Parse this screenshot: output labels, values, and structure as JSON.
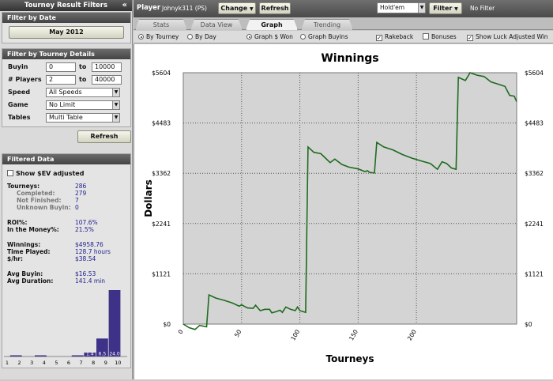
{
  "left": {
    "header": "Tourney Result Filters",
    "collapse_glyph": "«",
    "date_section": {
      "title": "Filter by Date",
      "button": "May 2012"
    },
    "details_section": {
      "title": "Filter by Tourney Details",
      "buyin_label": "Buyin",
      "buyin_min": "0",
      "buyin_to": "to",
      "buyin_max": "10000",
      "players_label": "# Players",
      "players_min": "2",
      "players_to": "to",
      "players_max": "40000",
      "speed_label": "Speed",
      "speed_value": "All Speeds",
      "game_label": "Game",
      "game_value": "No Limit",
      "tables_label": "Tables",
      "tables_value": "Multi Table"
    },
    "refresh_button": "Refresh",
    "filtered": {
      "title": "Filtered Data",
      "sev_label": "Show $EV adjusted",
      "tourneys_label": "Tourneys:",
      "tourneys": "286",
      "completed_label": "Completed:",
      "completed": "279",
      "not_finished_label": "Not Finished:",
      "not_finished": "7",
      "unknown_label": "Unknown Buyin:",
      "unknown": "0",
      "roi_label": "ROI%:",
      "roi": "107.6%",
      "itm_label": "In the Money%:",
      "itm": "21.5%",
      "winnings_label": "Winnings:",
      "winnings": "$4958.76",
      "time_label": "Time Played:",
      "time": "128.7 hours",
      "hr_label": "$/hr:",
      "hr": "$38.54",
      "avg_buyin_label": "Avg Buyin:",
      "avg_buyin": "$16.53",
      "avg_dur_label": "Avg Duration:",
      "avg_dur": "141.4 min"
    },
    "finish_chart": {
      "x_labels": [
        "1",
        "2",
        "3",
        "4",
        "5",
        "6",
        "7",
        "8",
        "9",
        "10"
      ],
      "bars": [
        {
          "pos": 1,
          "value": 0.3
        },
        {
          "pos": 3,
          "value": 0.3
        },
        {
          "pos": 6,
          "value": 0.3
        },
        {
          "pos": 7,
          "value": 1.4,
          "label": "1.4"
        },
        {
          "pos": 8,
          "value": 6.5,
          "label": "6.5"
        },
        {
          "pos": 9,
          "value": 24.0,
          "label": "24.0"
        }
      ],
      "color": "#3d3188"
    }
  },
  "topbar": {
    "player_label": "Player",
    "player_name": "Johnyk311 (PS)",
    "change_btn": "Change",
    "refresh_btn": "Refresh",
    "game_select": "Hold'em",
    "filter_btn": "Filter",
    "filter_status": "No Filter"
  },
  "tabs": [
    "Stats",
    "Data View",
    "Graph",
    "Trending"
  ],
  "active_tab": "Graph",
  "options": {
    "by_tourney": "By Tourney",
    "by_day": "By Day",
    "graph_won": "Graph $ Won",
    "graph_buyins": "Graph Buyins",
    "rakeback": "Rakeback",
    "bonuses": "Bonuses",
    "luck": "Show Luck Adjusted Win"
  },
  "chart_data": {
    "type": "line",
    "title": "Winnings",
    "xlabel": "Tourneys",
    "ylabel": "Dollars",
    "xlim": [
      0,
      286
    ],
    "ylim": [
      0,
      5604
    ],
    "yticks": [
      "$0",
      "$1121",
      "$2241",
      "$3362",
      "$4483",
      "$5604"
    ],
    "xticks": [
      "0",
      "50",
      "100",
      "150",
      "200"
    ],
    "grid": true,
    "series": [
      {
        "color": "#1e6b1e",
        "points": [
          [
            0,
            0
          ],
          [
            5,
            -80
          ],
          [
            10,
            -120
          ],
          [
            14,
            -30
          ],
          [
            20,
            -60
          ],
          [
            22,
            650
          ],
          [
            28,
            580
          ],
          [
            35,
            530
          ],
          [
            42,
            470
          ],
          [
            48,
            400
          ],
          [
            50,
            430
          ],
          [
            55,
            360
          ],
          [
            60,
            350
          ],
          [
            62,
            420
          ],
          [
            66,
            300
          ],
          [
            70,
            330
          ],
          [
            74,
            330
          ],
          [
            76,
            250
          ],
          [
            80,
            280
          ],
          [
            83,
            310
          ],
          [
            85,
            260
          ],
          [
            88,
            380
          ],
          [
            92,
            330
          ],
          [
            96,
            300
          ],
          [
            98,
            380
          ],
          [
            100,
            300
          ],
          [
            105,
            260
          ],
          [
            107,
            3950
          ],
          [
            112,
            3830
          ],
          [
            118,
            3800
          ],
          [
            122,
            3700
          ],
          [
            126,
            3600
          ],
          [
            130,
            3680
          ],
          [
            136,
            3560
          ],
          [
            142,
            3500
          ],
          [
            150,
            3460
          ],
          [
            156,
            3400
          ],
          [
            158,
            3420
          ],
          [
            160,
            3380
          ],
          [
            164,
            3370
          ],
          [
            166,
            4050
          ],
          [
            172,
            3950
          ],
          [
            180,
            3880
          ],
          [
            188,
            3780
          ],
          [
            196,
            3700
          ],
          [
            205,
            3630
          ],
          [
            212,
            3580
          ],
          [
            218,
            3450
          ],
          [
            222,
            3620
          ],
          [
            226,
            3580
          ],
          [
            230,
            3480
          ],
          [
            234,
            3450
          ],
          [
            236,
            5500
          ],
          [
            242,
            5430
          ],
          [
            246,
            5604
          ],
          [
            252,
            5550
          ],
          [
            258,
            5520
          ],
          [
            264,
            5400
          ],
          [
            270,
            5350
          ],
          [
            276,
            5300
          ],
          [
            280,
            5100
          ],
          [
            284,
            5080
          ],
          [
            286,
            4959
          ]
        ]
      }
    ]
  }
}
